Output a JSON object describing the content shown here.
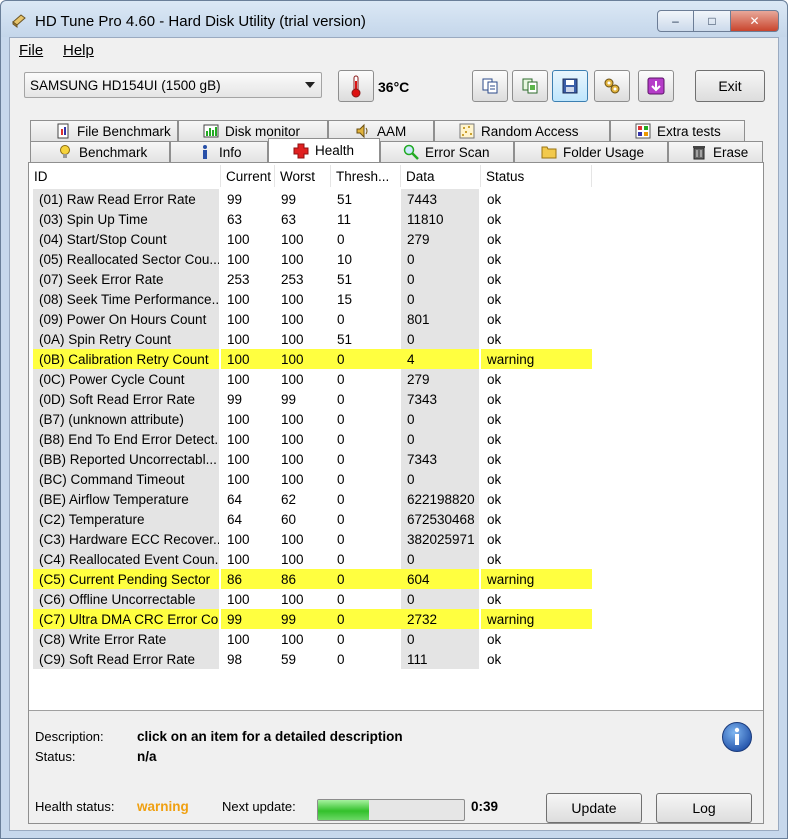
{
  "window": {
    "title": "HD Tune Pro 4.60 - Hard Disk Utility (trial version)",
    "min_glyph": "–",
    "max_glyph": "□",
    "close_glyph": "✕"
  },
  "menu": {
    "file": "File",
    "help": "Help"
  },
  "toolbar": {
    "drive": "SAMSUNG HD154UI (1500 gB)",
    "temperature": "36°C",
    "exit_label": "Exit"
  },
  "tabs": {
    "row1": [
      "File Benchmark",
      "Disk monitor",
      "AAM",
      "Random Access",
      "Extra tests"
    ],
    "row2": [
      "Benchmark",
      "Info",
      "Health",
      "Error Scan",
      "Folder Usage",
      "Erase"
    ],
    "selected": "Health"
  },
  "grid": {
    "columns": [
      "ID",
      "Current",
      "Worst",
      "Thresh...",
      "Data",
      "Status"
    ],
    "rows": [
      {
        "id": "(01) Raw Read Error Rate",
        "current": "99",
        "worst": "99",
        "thresh": "51",
        "data": "7443",
        "status": "ok"
      },
      {
        "id": "(03) Spin Up Time",
        "current": "63",
        "worst": "63",
        "thresh": "11",
        "data": "11810",
        "status": "ok"
      },
      {
        "id": "(04) Start/Stop Count",
        "current": "100",
        "worst": "100",
        "thresh": "0",
        "data": "279",
        "status": "ok"
      },
      {
        "id": "(05) Reallocated Sector Cou...",
        "current": "100",
        "worst": "100",
        "thresh": "10",
        "data": "0",
        "status": "ok"
      },
      {
        "id": "(07) Seek Error Rate",
        "current": "253",
        "worst": "253",
        "thresh": "51",
        "data": "0",
        "status": "ok"
      },
      {
        "id": "(08) Seek Time Performance...",
        "current": "100",
        "worst": "100",
        "thresh": "15",
        "data": "0",
        "status": "ok"
      },
      {
        "id": "(09) Power On Hours Count",
        "current": "100",
        "worst": "100",
        "thresh": "0",
        "data": "801",
        "status": "ok"
      },
      {
        "id": "(0A) Spin Retry Count",
        "current": "100",
        "worst": "100",
        "thresh": "51",
        "data": "0",
        "status": "ok"
      },
      {
        "id": "(0B) Calibration Retry Count",
        "current": "100",
        "worst": "100",
        "thresh": "0",
        "data": "4",
        "status": "warning"
      },
      {
        "id": "(0C) Power Cycle Count",
        "current": "100",
        "worst": "100",
        "thresh": "0",
        "data": "279",
        "status": "ok"
      },
      {
        "id": "(0D) Soft Read Error Rate",
        "current": "99",
        "worst": "99",
        "thresh": "0",
        "data": "7343",
        "status": "ok"
      },
      {
        "id": "(B7) (unknown attribute)",
        "current": "100",
        "worst": "100",
        "thresh": "0",
        "data": "0",
        "status": "ok"
      },
      {
        "id": "(B8) End To End Error Detect...",
        "current": "100",
        "worst": "100",
        "thresh": "0",
        "data": "0",
        "status": "ok"
      },
      {
        "id": "(BB) Reported Uncorrectabl...",
        "current": "100",
        "worst": "100",
        "thresh": "0",
        "data": "7343",
        "status": "ok"
      },
      {
        "id": "(BC) Command Timeout",
        "current": "100",
        "worst": "100",
        "thresh": "0",
        "data": "0",
        "status": "ok"
      },
      {
        "id": "(BE) Airflow Temperature",
        "current": "64",
        "worst": "62",
        "thresh": "0",
        "data": "622198820",
        "status": "ok"
      },
      {
        "id": "(C2) Temperature",
        "current": "64",
        "worst": "60",
        "thresh": "0",
        "data": "672530468",
        "status": "ok"
      },
      {
        "id": "(C3) Hardware ECC Recover...",
        "current": "100",
        "worst": "100",
        "thresh": "0",
        "data": "382025971",
        "status": "ok"
      },
      {
        "id": "(C4) Reallocated Event Coun...",
        "current": "100",
        "worst": "100",
        "thresh": "0",
        "data": "0",
        "status": "ok"
      },
      {
        "id": "(C5) Current Pending Sector",
        "current": "86",
        "worst": "86",
        "thresh": "0",
        "data": "604",
        "status": "warning"
      },
      {
        "id": "(C6) Offline Uncorrectable",
        "current": "100",
        "worst": "100",
        "thresh": "0",
        "data": "0",
        "status": "ok"
      },
      {
        "id": "(C7) Ultra DMA CRC Error Co...",
        "current": "99",
        "worst": "99",
        "thresh": "0",
        "data": "2732",
        "status": "warning"
      },
      {
        "id": "(C8) Write Error Rate",
        "current": "100",
        "worst": "100",
        "thresh": "0",
        "data": "0",
        "status": "ok"
      },
      {
        "id": "(C9) Soft Read Error Rate",
        "current": "98",
        "worst": "59",
        "thresh": "0",
        "data": "111",
        "status": "ok"
      }
    ]
  },
  "info": {
    "description_label": "Description:",
    "description_value": "click on an item for a detailed description",
    "status_label": "Status:",
    "status_value": "n/a"
  },
  "footer": {
    "health_label": "Health status:",
    "health_value": "warning",
    "health_color": "#f0a010",
    "next_update_label": "Next update:",
    "next_update_progress": 0.35,
    "next_update_time": "0:39",
    "update_label": "Update",
    "log_label": "Log"
  },
  "colors": {
    "warning_row": "#ffff40",
    "window_frame": "#c7d8ec"
  }
}
